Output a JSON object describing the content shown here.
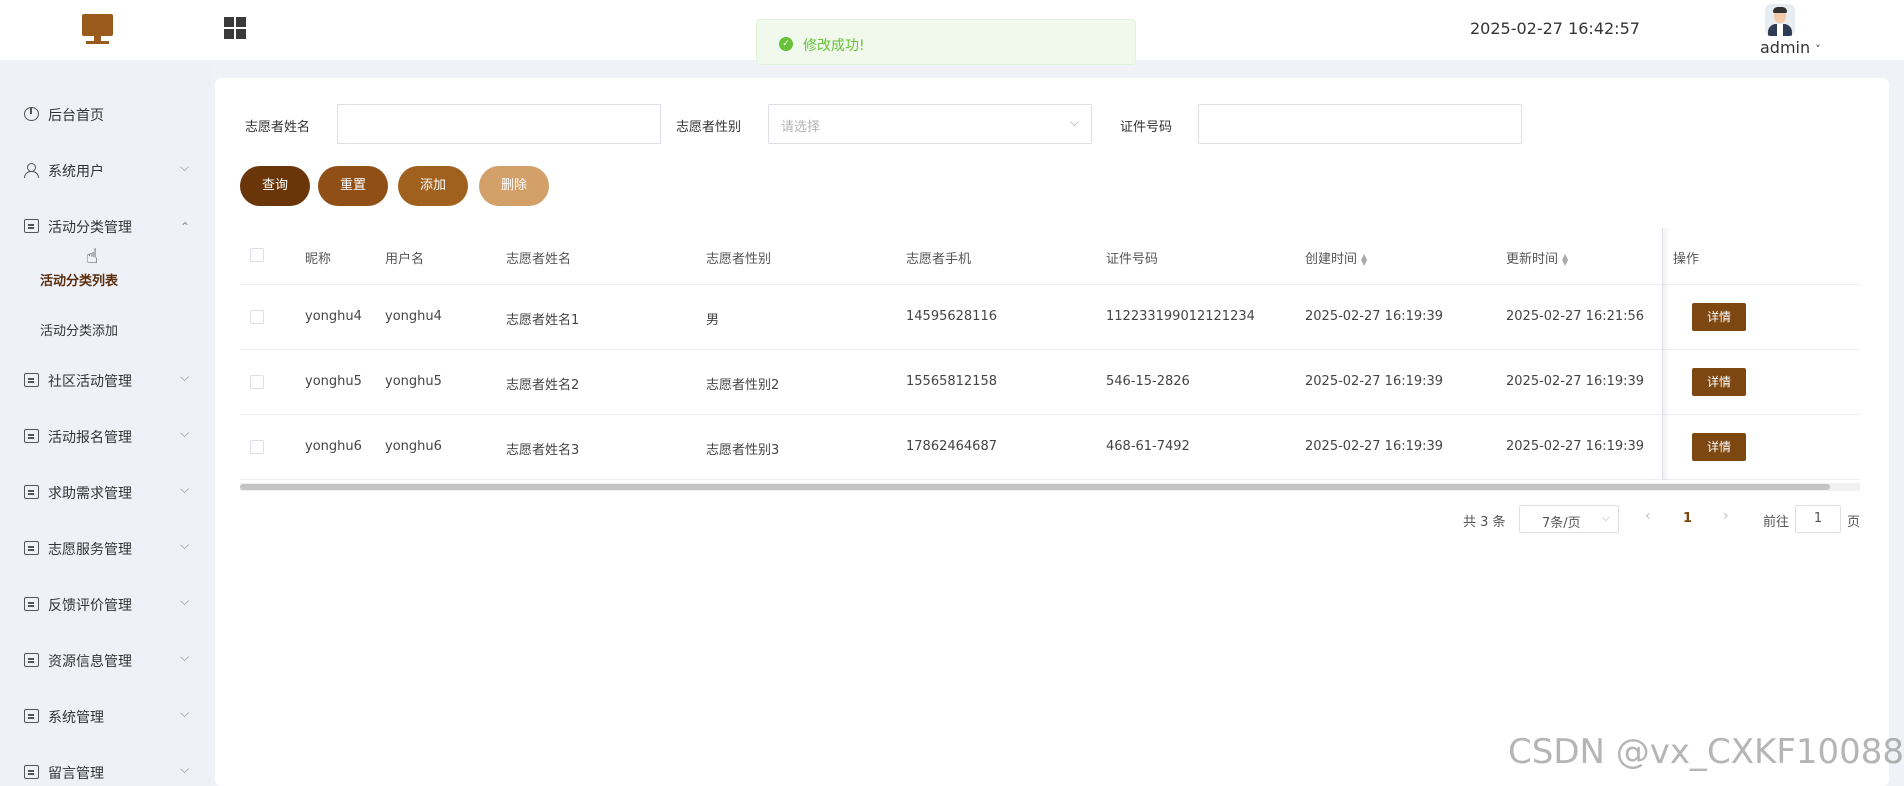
{
  "header": {
    "datetime": "2025-02-27 16:42:57",
    "username": "admin",
    "user_caret": "˅"
  },
  "toast": {
    "message": "修改成功!",
    "icon": "check-circle-icon",
    "color": "#67c23a"
  },
  "sidebar": {
    "items": [
      {
        "label": "后台首页",
        "icon": "clock-icon"
      },
      {
        "label": "系统用户",
        "icon": "user-icon",
        "arrow": "⌵"
      },
      {
        "label": "活动分类管理",
        "icon": "doc-icon",
        "arrow": "⌃",
        "expanded": true,
        "children": [
          "活动分类列表",
          "活动分类添加"
        ],
        "active_child": "活动分类列表"
      },
      {
        "label": "社区活动管理",
        "icon": "doc-icon",
        "arrow": "⌵"
      },
      {
        "label": "活动报名管理",
        "icon": "doc-icon",
        "arrow": "⌵"
      },
      {
        "label": "求助需求管理",
        "icon": "doc-icon",
        "arrow": "⌵"
      },
      {
        "label": "志愿服务管理",
        "icon": "doc-icon",
        "arrow": "⌵"
      },
      {
        "label": "反馈评价管理",
        "icon": "doc-icon",
        "arrow": "⌵"
      },
      {
        "label": "资源信息管理",
        "icon": "doc-icon",
        "arrow": "⌵"
      },
      {
        "label": "系统管理",
        "icon": "doc-check-icon",
        "arrow": "⌵"
      },
      {
        "label": "留言管理",
        "icon": "doc-check-icon",
        "arrow": "⌵"
      }
    ]
  },
  "search": {
    "name_label": "志愿者姓名",
    "name_value": "",
    "gender_label": "志愿者性别",
    "gender_placeholder": "请选择",
    "id_label": "证件号码",
    "id_value": ""
  },
  "buttons": {
    "query": "查询",
    "reset": "重置",
    "add": "添加",
    "delete": "删除"
  },
  "colors": {
    "query": "#6a3508",
    "reset": "#8f4f16",
    "add": "#a0601e",
    "delete": "#d4a06a",
    "detail": "#7d4711"
  },
  "table": {
    "columns": [
      "昵称",
      "用户名",
      "志愿者姓名",
      "志愿者性别",
      "志愿者手机",
      "证件号码",
      "创建时间",
      "更新时间",
      "操作"
    ],
    "rows": [
      [
        "yonghu4",
        "yonghu4",
        "志愿者姓名1",
        "男",
        "14595628116",
        "112233199012121234",
        "2025-02-27 16:19:39",
        "2025-02-27 16:21:56"
      ],
      [
        "yonghu5",
        "yonghu5",
        "志愿者姓名2",
        "志愿者性别2",
        "15565812158",
        "546-15-2826",
        "2025-02-27 16:19:39",
        "2025-02-27 16:19:39"
      ],
      [
        "yonghu6",
        "yonghu6",
        "志愿者姓名3",
        "志愿者性别3",
        "17862464687",
        "468-61-7492",
        "2025-02-27 16:19:39",
        "2025-02-27 16:19:39"
      ]
    ],
    "detail_label": "详情"
  },
  "pagination": {
    "total": "共 3 条",
    "page_size": "7条/页",
    "current": "1",
    "goto_prefix": "前往",
    "goto_value": "1",
    "goto_suffix": "页"
  },
  "watermark": "CSDN @vx_CXKF10088"
}
